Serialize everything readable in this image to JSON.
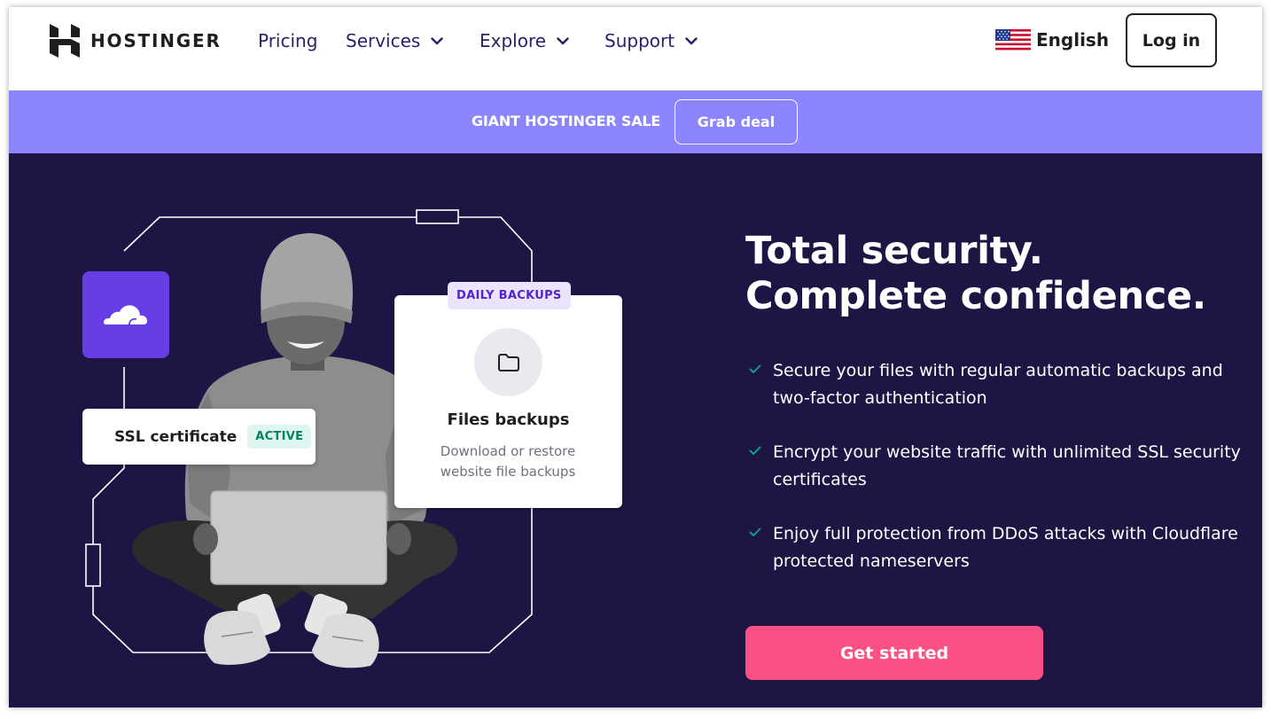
{
  "header": {
    "logo_text": "HOSTINGER",
    "nav": [
      {
        "label": "Pricing",
        "has_dropdown": false
      },
      {
        "label": "Services",
        "has_dropdown": true
      },
      {
        "label": "Explore",
        "has_dropdown": true
      },
      {
        "label": "Support",
        "has_dropdown": true
      }
    ],
    "language": {
      "label": "English",
      "flag_icon": "us-flag-icon"
    },
    "login_label": "Log in"
  },
  "promo": {
    "text": "GIANT HOSTINGER SALE",
    "button_label": "Grab deal"
  },
  "hero": {
    "illustration": {
      "cloudflare_icon": "cloud-icon",
      "ssl_card": {
        "title": "SSL certificate",
        "badge": "ACTIVE"
      },
      "backup_card": {
        "badge": "DAILY BACKUPS",
        "icon": "folder-icon",
        "title": "Files backups",
        "description": "Download or restore website file backups"
      }
    },
    "headline_line1": "Total security.",
    "headline_line2": "Complete confidence.",
    "features": [
      "Secure your files with regular automatic backups and two-factor authentication",
      "Encrypt your website traffic with unlimited SSL security certificates",
      "Enjoy full protection from DDoS attacks with Cloudflare protected nameservers"
    ],
    "cta_label": "Get started"
  },
  "colors": {
    "hero_bg": "#1f1545",
    "promo_bg": "#8c85ff",
    "accent_purple": "#673de6",
    "cta_pink": "#fc5185",
    "check_green": "#00b090"
  }
}
